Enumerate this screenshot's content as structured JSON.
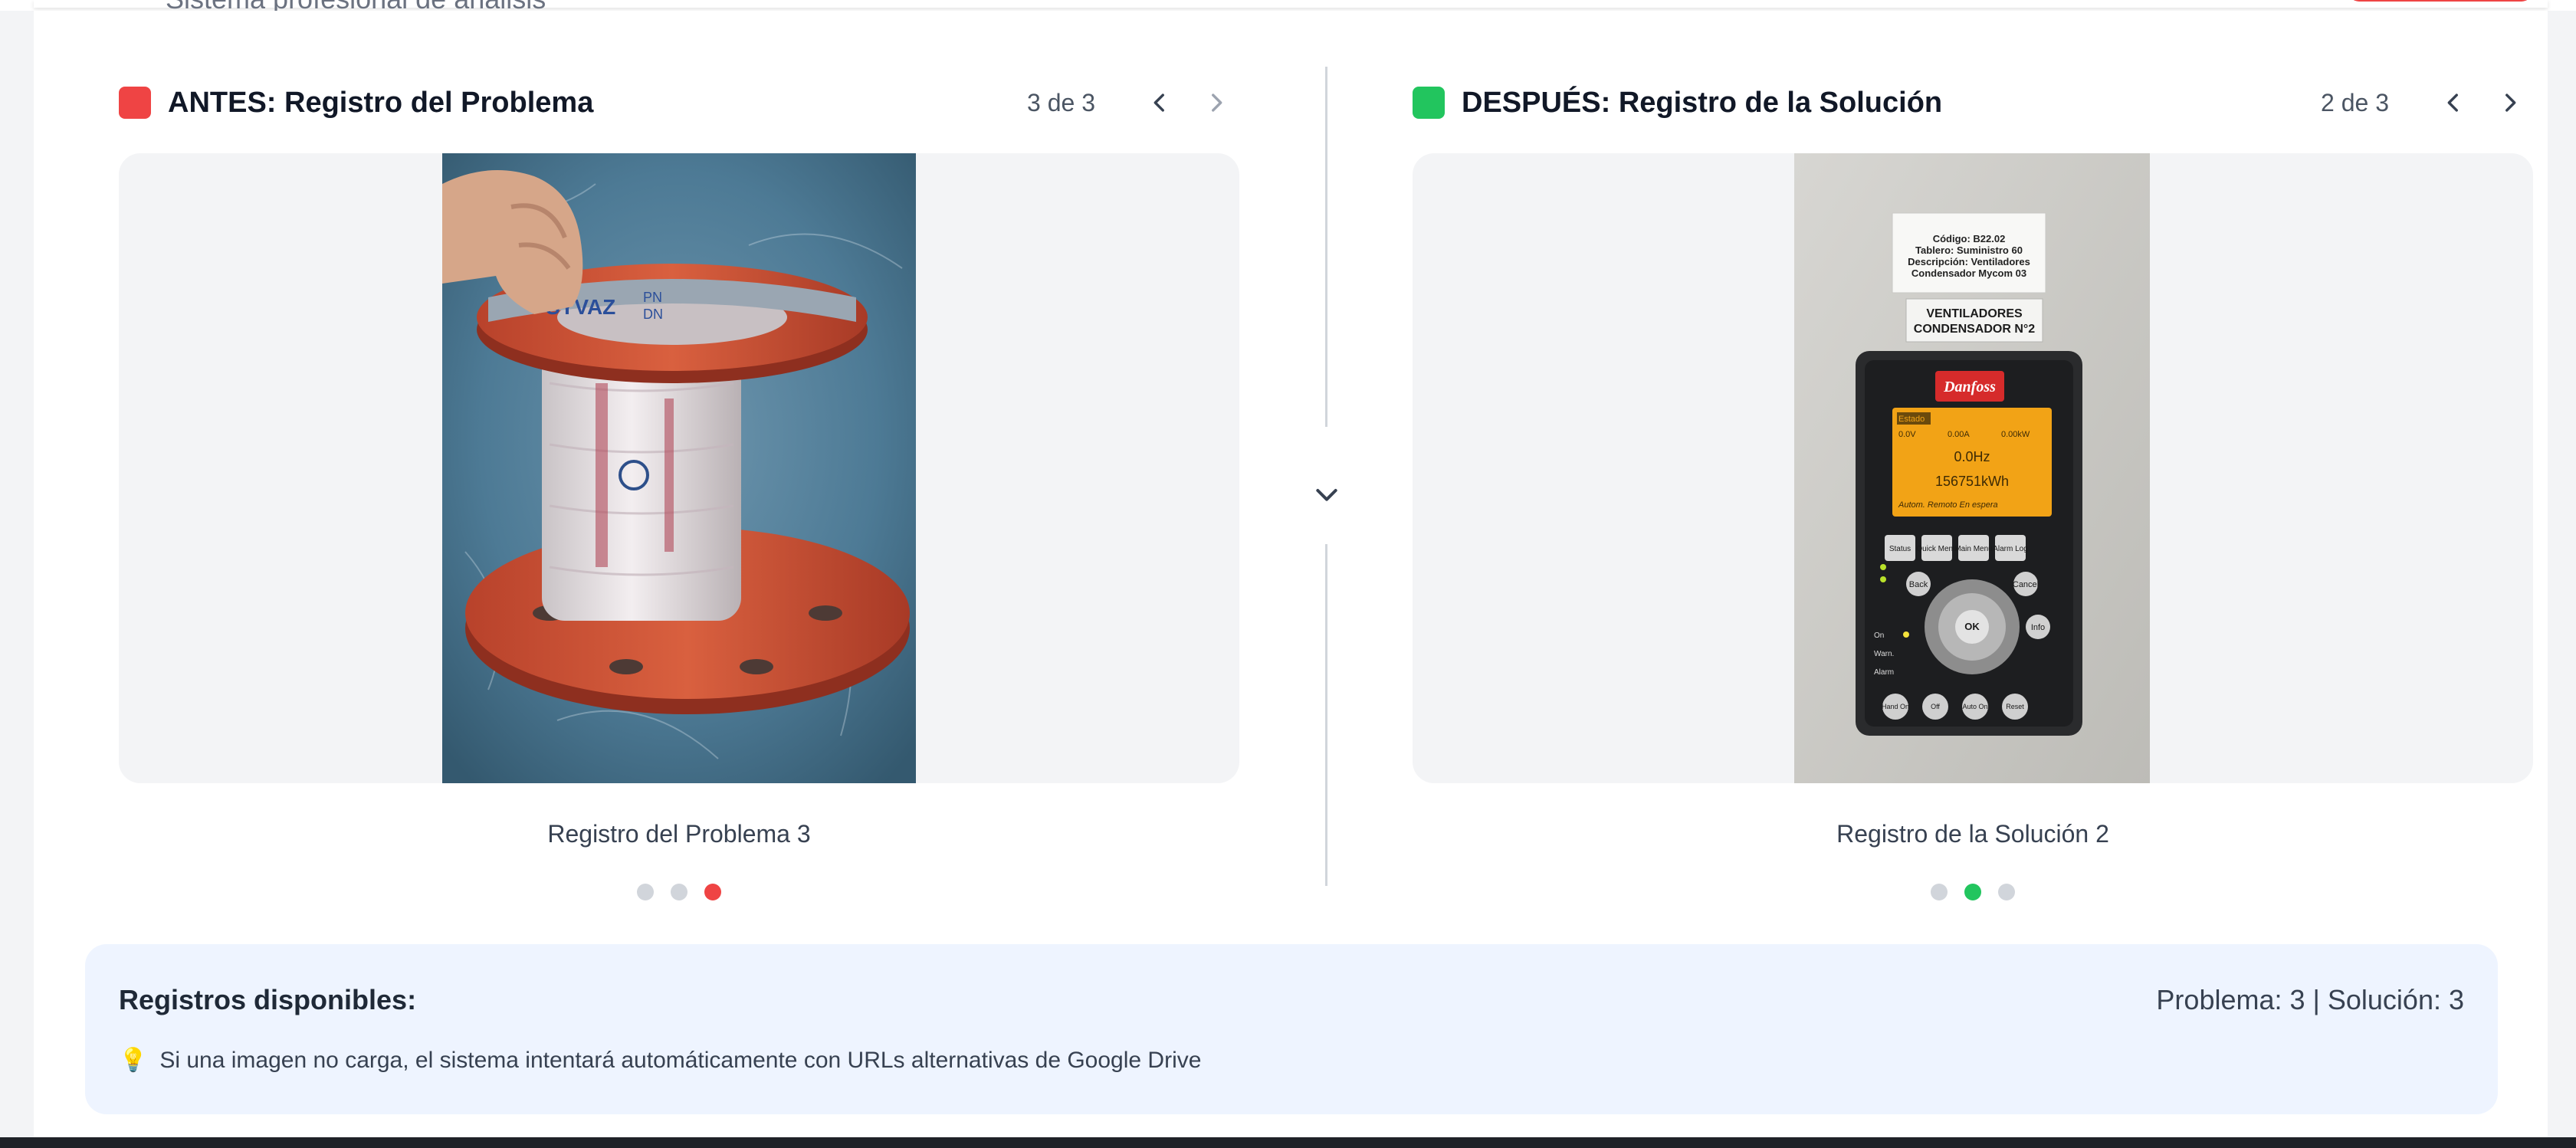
{
  "header": {
    "subtitle": "Sistema profesional de análisis"
  },
  "before": {
    "title": "ANTES: Registro del Problema",
    "counter": "3 de 3",
    "caption": "Registro del Problema 3",
    "total": 3,
    "current": 3,
    "accent": "#ef4444",
    "prev_icon": "chevron-left-icon",
    "next_icon": "chevron-right-icon",
    "photo": {
      "tag_brand": "SYVAZ",
      "tag_pn": "PN",
      "tag_dn": "DN"
    }
  },
  "after": {
    "title": "DESPUÉS: Registro de la Solución",
    "counter": "2 de 3",
    "caption": "Registro de la Solución 2",
    "total": 3,
    "current": 2,
    "accent": "#22c55e",
    "prev_icon": "chevron-left-icon",
    "next_icon": "chevron-right-icon",
    "photo": {
      "label_lines": [
        "Código: B22.02",
        "Tablero: Suministro 60",
        "Descripción: Ventiladores",
        "Condensador Mycom 03"
      ],
      "sign_lines": [
        "VENTILADORES",
        "CONDENSADOR N°2"
      ],
      "brand": "Danfoss",
      "display_status": "Estado",
      "display_row1": [
        "0.0V",
        "0.00A",
        "0.00kW"
      ],
      "display_hz": "0.0Hz",
      "display_kwh": "156751kWh",
      "display_footer": "Autom. Remoto En espera",
      "keys_top": [
        "Status",
        "Quick Menu",
        "Main Menu",
        "Alarm Log"
      ],
      "keys_nav": [
        "Back",
        "Cancel",
        "Info",
        "OK"
      ],
      "leds": [
        "On",
        "Warn.",
        "Alarm"
      ],
      "keys_bottom": [
        "Hand On",
        "Off",
        "Auto On",
        "Reset"
      ]
    }
  },
  "toggle_icon": "chevron-down-icon",
  "info": {
    "title": "Registros disponibles:",
    "counts": "Problema: 3 | Solución: 3",
    "hint_icon": "lightbulb-icon",
    "hint": "Si una imagen no carga, el sistema intentará automáticamente con URLs alternativas de Google Drive"
  }
}
